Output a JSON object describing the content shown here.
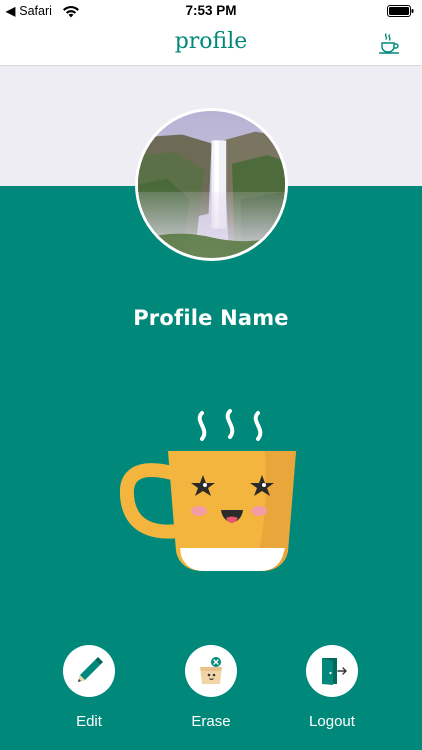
{
  "status_bar": {
    "carrier": "Safari",
    "time": "7:53 PM"
  },
  "nav": {
    "title": "profile",
    "right_icon": "coffee-cup-icon"
  },
  "profile": {
    "name": "Profile Name",
    "avatar_icon": "waterfall-landscape-photo"
  },
  "mascot": {
    "icon": "kawaii-coffee-cup"
  },
  "actions": [
    {
      "label": "Edit",
      "icon": "pencil-icon"
    },
    {
      "label": "Erase",
      "icon": "erase-box-icon"
    },
    {
      "label": "Logout",
      "icon": "door-exit-icon"
    }
  ],
  "colors": {
    "primary": "#00897B",
    "header_band": "#EEEDF3",
    "mug": "#F4B53F",
    "white": "#FFFFFF"
  }
}
